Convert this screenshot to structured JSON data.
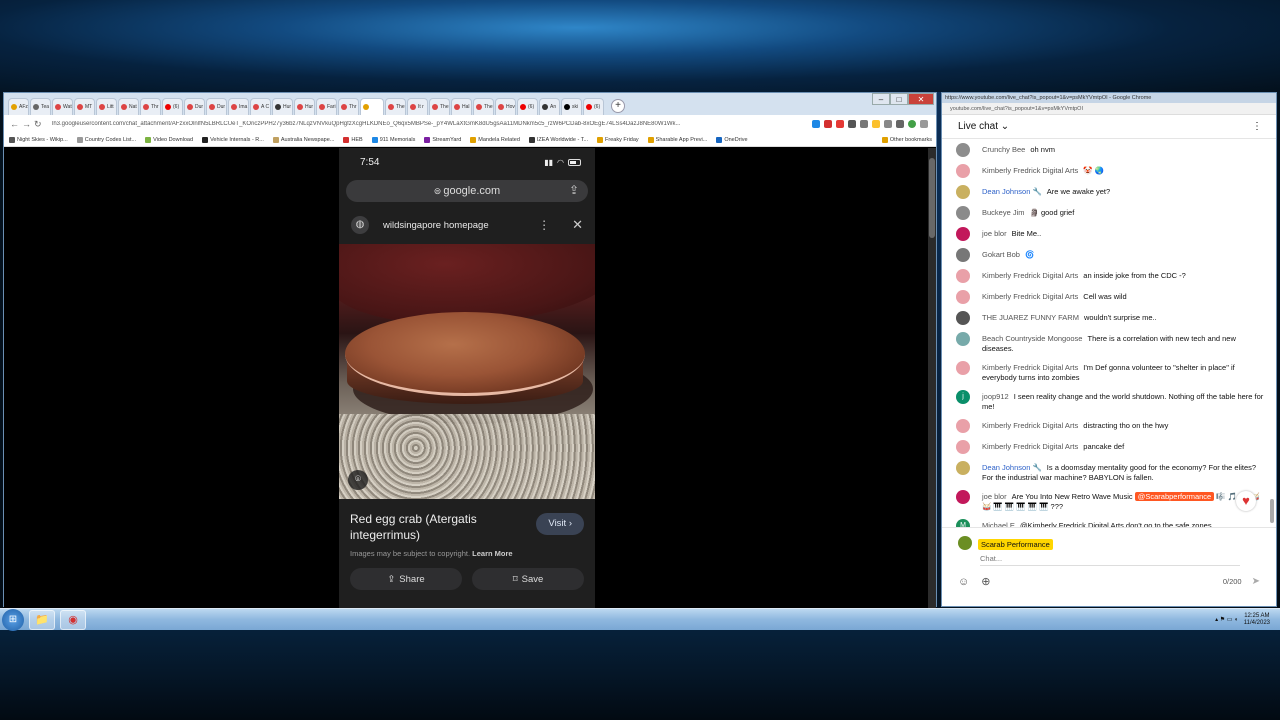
{
  "tabs": [
    {
      "label": "AFz",
      "color": "#e2a000"
    },
    {
      "label": "Tea",
      "color": "#666"
    },
    {
      "label": "Wat",
      "color": "#d44"
    },
    {
      "label": "MT",
      "color": "#d44"
    },
    {
      "label": "Litt",
      "color": "#d44"
    },
    {
      "label": "Nat",
      "color": "#d44"
    },
    {
      "label": "Thr",
      "color": "#d44"
    },
    {
      "label": "(6)",
      "color": "#e00"
    },
    {
      "label": "Dur",
      "color": "#d44"
    },
    {
      "label": "Dur",
      "color": "#d44"
    },
    {
      "label": "Ima",
      "color": "#d44"
    },
    {
      "label": "A C",
      "color": "#d44"
    },
    {
      "label": "Hur",
      "color": "#333"
    },
    {
      "label": "Hur",
      "color": "#d44"
    },
    {
      "label": "Fari",
      "color": "#d44"
    },
    {
      "label": "Thr",
      "color": "#d44"
    },
    {
      "label": "",
      "color": "#e2a000",
      "active": true
    },
    {
      "label": "The",
      "color": "#d44"
    },
    {
      "label": "It r",
      "color": "#d44"
    },
    {
      "label": "The",
      "color": "#d44"
    },
    {
      "label": "Hal",
      "color": "#d44"
    },
    {
      "label": "The",
      "color": "#d44"
    },
    {
      "label": "Hov",
      "color": "#d44"
    },
    {
      "label": "(6)",
      "color": "#e00"
    },
    {
      "label": "An",
      "color": "#333"
    },
    {
      "label": "ski",
      "color": "#000"
    },
    {
      "label": "(6)",
      "color": "#e00"
    }
  ],
  "address": "lh3.googleusercontent.com/chat_attachment/AFzxxOlnlfN5LBRLCUeT_KOriczPPH27y36bz7NLqzVNVkuQpHgfzXcgHLKDNEo_Q6qx5MBPSe-_pY4WLaXtGmK8dU5gsAa11MDNkm5c5_rzW6PCDab-8xOEgE74LSs4DazJ8NE80W1Wk...",
  "bookmarks": [
    {
      "label": "Night Skies - Wikip...",
      "color": "#555"
    },
    {
      "label": "Country Codes List...",
      "color": "#999"
    },
    {
      "label": "Video Download",
      "color": "#7cb342"
    },
    {
      "label": "Vehicle Internals - R...",
      "color": "#222"
    },
    {
      "label": "Australia Newspape...",
      "color": "#c0a060"
    },
    {
      "label": "HEB",
      "color": "#d32f2f"
    },
    {
      "label": "911 Memorials",
      "color": "#1e88e5"
    },
    {
      "label": "StreamYard",
      "color": "#7b1fa2"
    },
    {
      "label": "Mandela Related",
      "color": "#e0a000"
    },
    {
      "label": "IZEA Worldwide - T...",
      "color": "#333"
    },
    {
      "label": "Freaky Friday",
      "color": "#e0a000"
    },
    {
      "label": "Sharable App Previ...",
      "color": "#e0a000"
    },
    {
      "label": "OneDrive",
      "color": "#1565c0"
    }
  ],
  "other_bookmarks": "Other bookmarks",
  "phone": {
    "time": "7:54",
    "domain": "google.com",
    "site_title": "wildsingapore homepage",
    "caption": "Red egg crab (Atergatis integerrimus)",
    "visit": "Visit",
    "copyright": "Images may be subject to copyright.",
    "learn_more": "Learn More",
    "share": "Share",
    "save": "Save"
  },
  "chat": {
    "window_title": "https://www.youtube.com/live_chat?is_popout=1&v=psMkYVmtpOI - Google Chrome",
    "url": "youtube.com/live_chat?is_popout=1&v=psMkYVmtpOI",
    "header": "Live chat",
    "messages": [
      {
        "author": "Crunchy Bee",
        "text": "oh nvm",
        "color": "#8d8d8d",
        "initial": ""
      },
      {
        "author": "Kimberly Fredrick Digital Arts",
        "text": "🤡 🌏",
        "color": "#e9a0a8",
        "initial": ""
      },
      {
        "author": "Dean Johnson 🔧",
        "text": "Are we awake yet?",
        "color": "#c9b060",
        "initial": "",
        "mod": true
      },
      {
        "author": "Buckeye Jim",
        "text": "🗿 good grief",
        "color": "#8a8a8a",
        "initial": ""
      },
      {
        "author": "joe blor",
        "text": "Bite Me..",
        "color": "#c2185b",
        "initial": ""
      },
      {
        "author": "Gokart Bob",
        "text": "🌀",
        "color": "#777",
        "initial": ""
      },
      {
        "author": "Kimberly Fredrick Digital Arts",
        "text": "an inside joke from the CDC -?",
        "color": "#e9a0a8",
        "initial": ""
      },
      {
        "author": "Kimberly Fredrick Digital Arts",
        "text": "Cell was wild",
        "color": "#e9a0a8",
        "initial": ""
      },
      {
        "author": "THE JUAREZ FUNNY FARM",
        "text": "wouldn't surprise me..",
        "color": "#555",
        "initial": ""
      },
      {
        "author": "Beach Countryside Mongoose",
        "text": "There is a correlation with new tech and new diseases.",
        "color": "#7aa",
        "initial": ""
      },
      {
        "author": "Kimberly Fredrick Digital Arts",
        "text": "I'm Def gonna volunteer to \"shelter in place\" if everybody turns into zombies",
        "color": "#e9a0a8",
        "initial": ""
      },
      {
        "author": "joop912",
        "text": "I seen reality change and the world shutdown. Nothing off the table here for me!",
        "color": "#0a8f6a",
        "initial": "j"
      },
      {
        "author": "Kimberly Fredrick Digital Arts",
        "text": "distracting tho on the hwy",
        "color": "#e9a0a8",
        "initial": ""
      },
      {
        "author": "Kimberly Fredrick Digital Arts",
        "text": "pancake def",
        "color": "#e9a0a8",
        "initial": ""
      },
      {
        "author": "Dean Johnson 🔧",
        "text": "Is a doomsday mentality good for the economy? For the elites? For the industrial war machine? BABYLON is fallen.",
        "color": "#c9b060",
        "initial": "",
        "mod": true
      },
      {
        "author": "joe blor",
        "text": "Are You Into New Retro Wave Music",
        "mention": "@Scarabperformance",
        "tail": "🎼 🎵 🎶 🥁 🥁 🎹 🎹 🎹 🎹 🎹 ???",
        "color": "#c2185b",
        "initial": ""
      },
      {
        "author": "Michael E",
        "text": "@Kimberly Fredrick Digital Arts don't go to the safe zones",
        "color": "#1b8f5a",
        "initial": "M"
      }
    ],
    "me": "Scarab Performance",
    "placeholder": "Chat...",
    "counter": "0/200"
  },
  "taskbar": {
    "time": "12:25 AM",
    "date": "11/4/2023"
  }
}
